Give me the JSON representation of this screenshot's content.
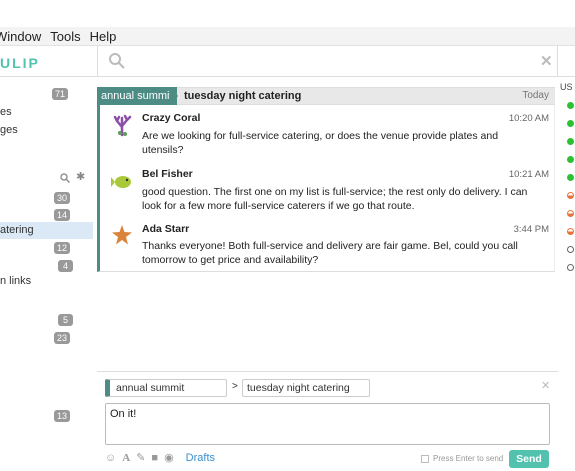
{
  "menubar": {
    "items": [
      "Window",
      "Tools",
      "Help"
    ]
  },
  "header": {
    "logo": "ULIP"
  },
  "left": {
    "badge_1": "71",
    "item_1": "es",
    "item_2": "ges",
    "badge_2": "30",
    "badge_3": "14",
    "selected": "atering",
    "badge_4": "12",
    "badge_5": "4",
    "links": "n links",
    "badge_6": "5",
    "badge_7": "23",
    "badge_8": "13"
  },
  "narrow": {
    "stream": "annual summit",
    "topic": "tuesday night catering",
    "date": "Today"
  },
  "messages": [
    {
      "sender": "Crazy Coral",
      "time": "10:20 AM",
      "text": "Are we looking for full-service catering, or does the venue provide plates and utensils?"
    },
    {
      "sender": "Bel Fisher",
      "time": "10:21 AM",
      "text": "good question. The first one on my list is full-service; the rest only do delivery. I can look for a few more full-service caterers if we go that route."
    },
    {
      "sender": "Ada Starr",
      "time": "3:44 PM",
      "text": "Thanks everyone! Both full-service and delivery are fair game. Bel, could you call tomorrow to get price and availability?"
    }
  ],
  "right": {
    "label": "US"
  },
  "compose": {
    "stream": "annual summit",
    "topic": "tuesday night catering",
    "text": "On it!",
    "drafts": "Drafts",
    "enter_label": "Press Enter to send",
    "send": "Send"
  },
  "colors": {
    "accent": "#52c2af",
    "stream": "#4c8c85",
    "link": "#3a8fd1"
  }
}
